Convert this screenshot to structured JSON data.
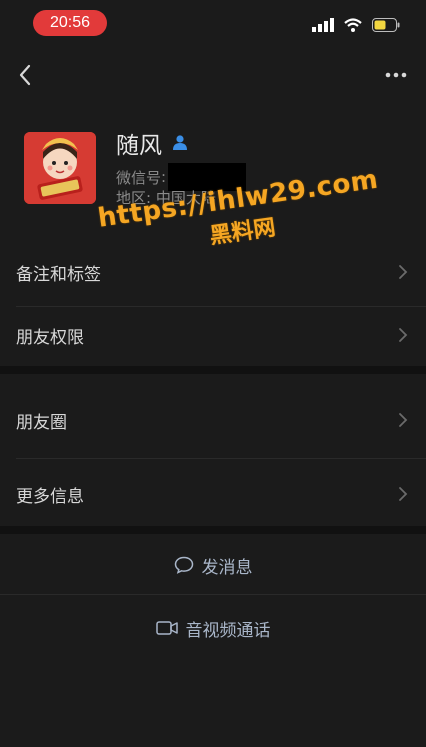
{
  "status": {
    "time": "20:56"
  },
  "profile": {
    "name": "随风",
    "wechat_id_label": "微信号",
    "region_label": "地区",
    "region_value": "中国大陆"
  },
  "menu": [
    {
      "label": "备注和标签"
    },
    {
      "label": "朋友权限"
    },
    {
      "label": "朋友圈"
    },
    {
      "label": "更多信息"
    }
  ],
  "actions": {
    "message": "发消息",
    "video_call": "音视频通话"
  },
  "watermark": {
    "url": "https://ihlw29.com",
    "text": "黑料网"
  },
  "colors": {
    "background": "#1b1b1b",
    "time_pill": "#e23a3a",
    "action_text": "#a9b6c9",
    "watermark": "#f5a623"
  }
}
